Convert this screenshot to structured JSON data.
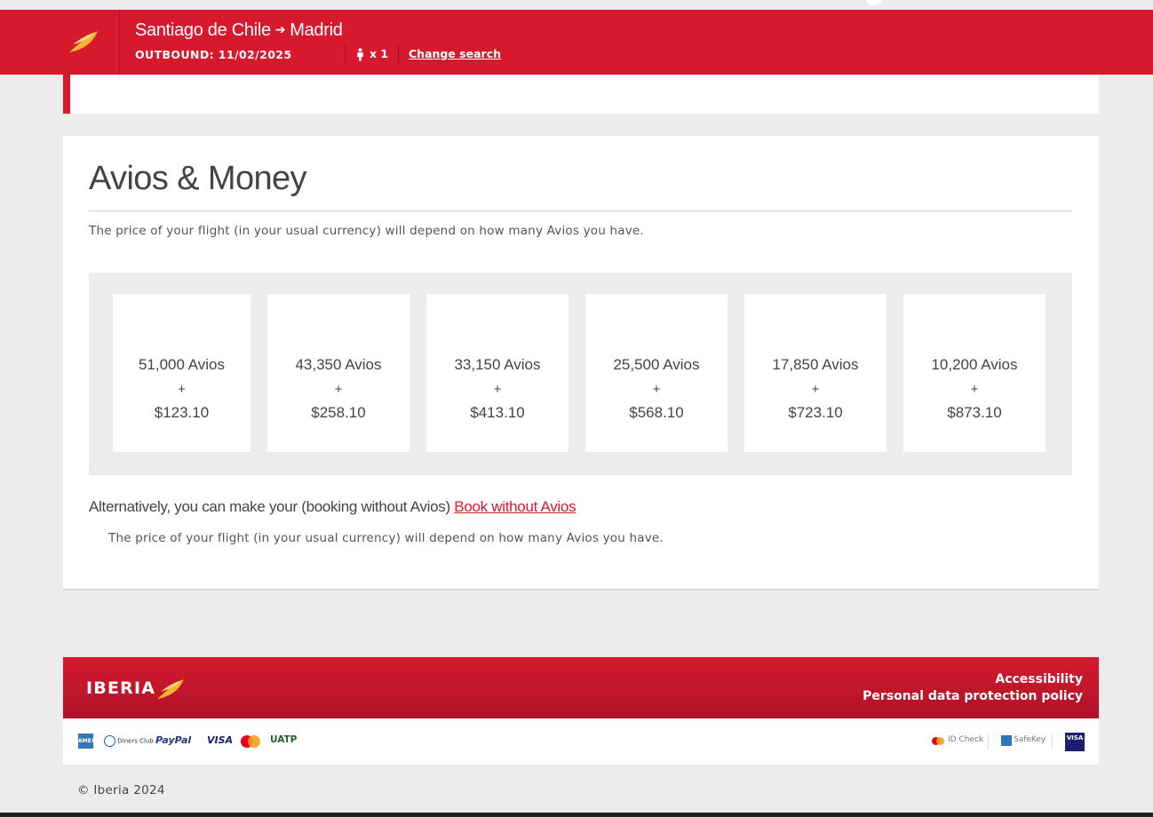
{
  "header": {
    "origin": "Santiago de Chile",
    "destination": "Madrid",
    "outbound": "OUTBOUND: 11/02/2025",
    "passengers": "x 1",
    "change_search": "Change search"
  },
  "avios": {
    "title": "Avios & Money",
    "description": "The price of your flight (in your usual currency) will depend on how many Avios you have.",
    "plus": "+",
    "options": [
      {
        "avios": "51,000 Avios",
        "money": "$123.10"
      },
      {
        "avios": "43,350 Avios",
        "money": "$258.10"
      },
      {
        "avios": "33,150 Avios",
        "money": "$413.10"
      },
      {
        "avios": "25,500 Avios",
        "money": "$568.10"
      },
      {
        "avios": "17,850 Avios",
        "money": "$723.10"
      },
      {
        "avios": "10,200 Avios",
        "money": "$873.10"
      }
    ],
    "alternative_text": "Alternatively, you can make your (booking without Avios)",
    "book_without_avios": "Book without Avios",
    "alternative_description": "The price of your flight (in your usual currency) will depend on how many Avios you have."
  },
  "footer": {
    "brand": "IBERIA",
    "accessibility": "Accessibility",
    "privacy": "Personal data protection policy",
    "payment_methods": [
      "AMEX",
      "Diners Club",
      "PayPal",
      "VISA",
      "UATP"
    ],
    "security": [
      "ID Check",
      "SafeKey",
      "VISA"
    ],
    "copyright": "© Iberia 2024"
  },
  "colors": {
    "brand_red": "#d7192d",
    "background": "#ececec"
  }
}
